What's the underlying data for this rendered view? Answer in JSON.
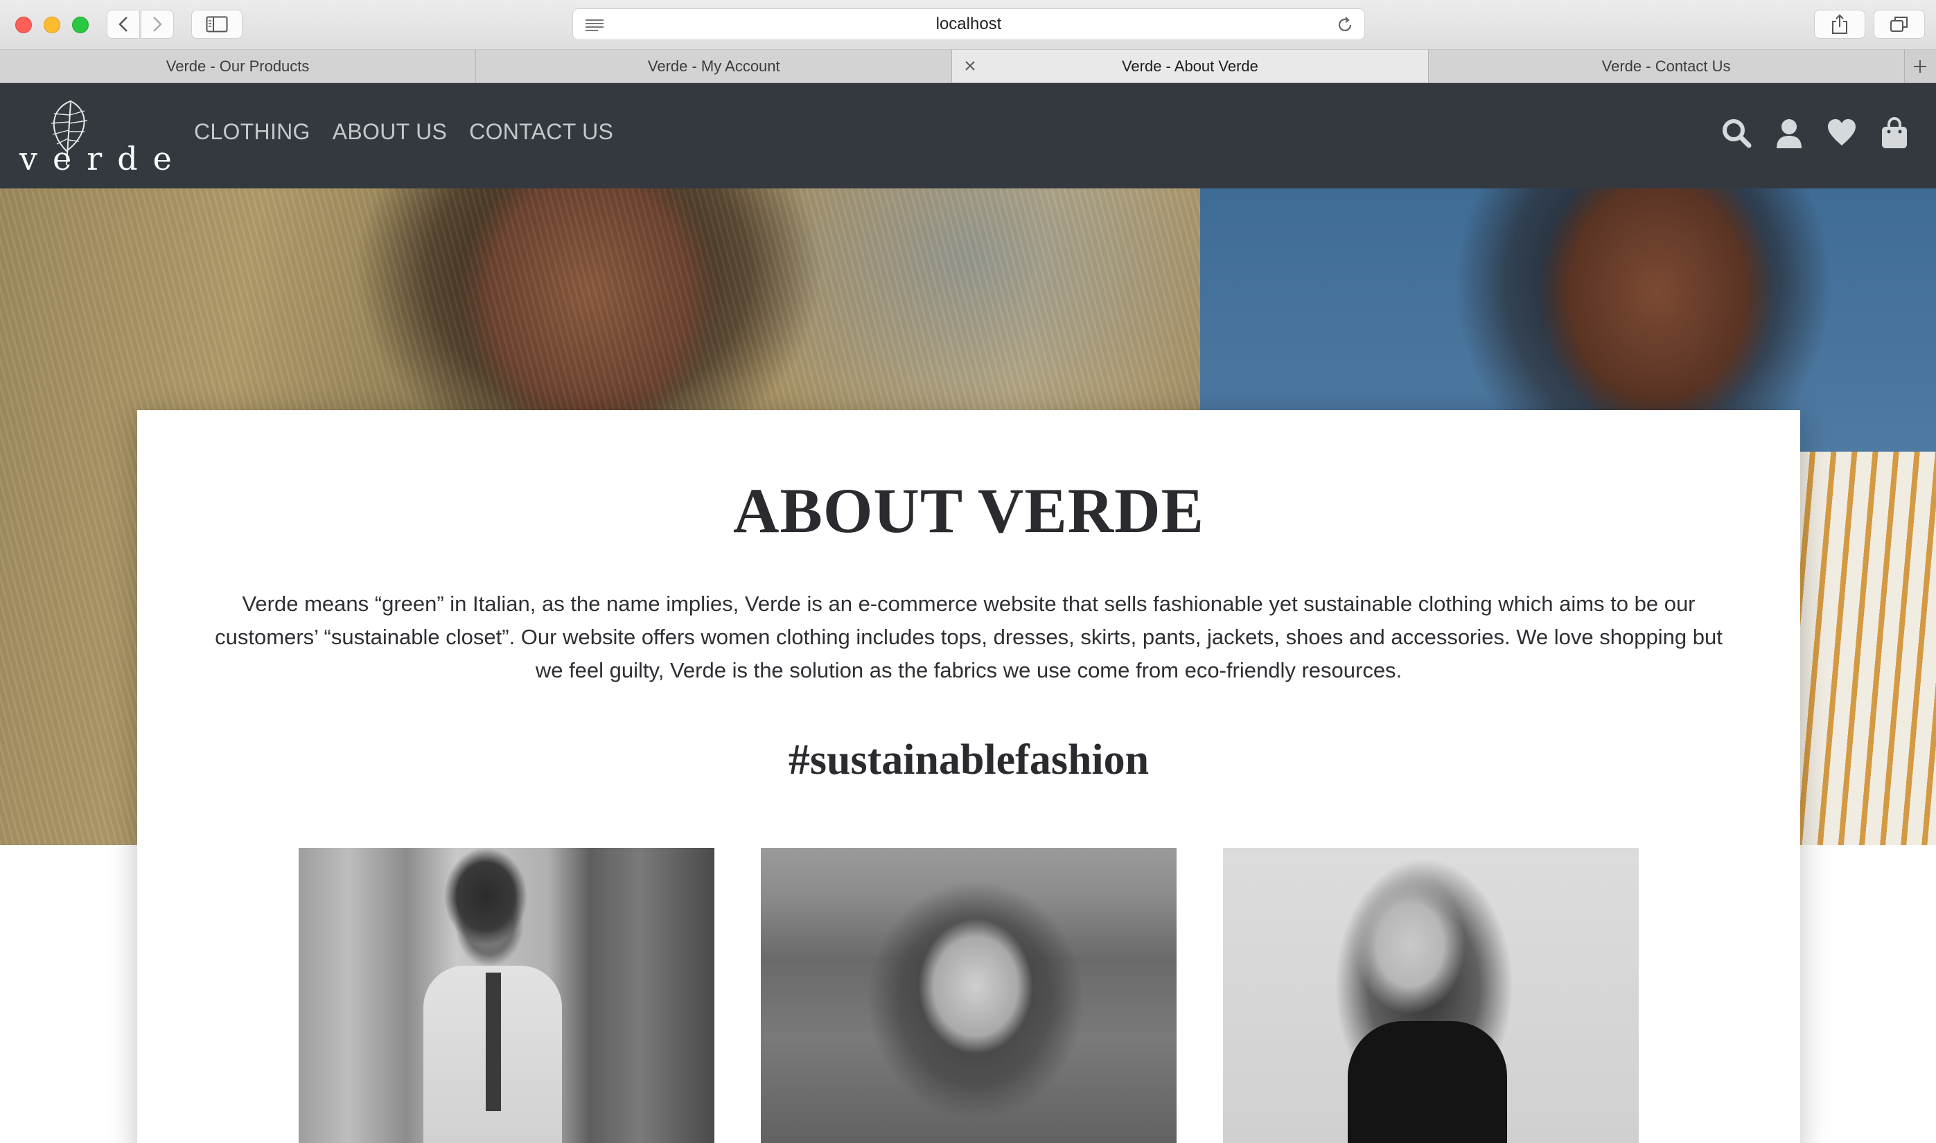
{
  "browser": {
    "url": "localhost",
    "tabs": [
      {
        "label": "Verde - Our Products",
        "active": false
      },
      {
        "label": "Verde - My Account",
        "active": false
      },
      {
        "label": "Verde - About Verde",
        "active": true
      },
      {
        "label": "Verde - Contact Us",
        "active": false
      }
    ]
  },
  "site": {
    "logo_text": "verde",
    "nav": [
      "CLOTHING",
      "ABOUT US",
      "CONTACT US"
    ],
    "header_icons": [
      "search-icon",
      "user-icon",
      "heart-icon",
      "shopping-bag-icon"
    ]
  },
  "about": {
    "title": "ABOUT VERDE",
    "text": "Verde means “green” in Italian, as the name implies, Verde is an e-commerce website that sells fashionable yet sustainable clothing which aims to be our customers’ “sustainable closet”. Our website offers women clothing includes tops, dresses, skirts, pants, jackets, shoes and accessories. We love shopping but we feel guilty, Verde is the solution as the fabrics we use come from eco-friendly resources.",
    "hashtag": "#sustainablefashion"
  },
  "colors": {
    "header_bg": "#33393f",
    "nav_text": "#c5c9cc",
    "card_bg": "#ffffff"
  }
}
